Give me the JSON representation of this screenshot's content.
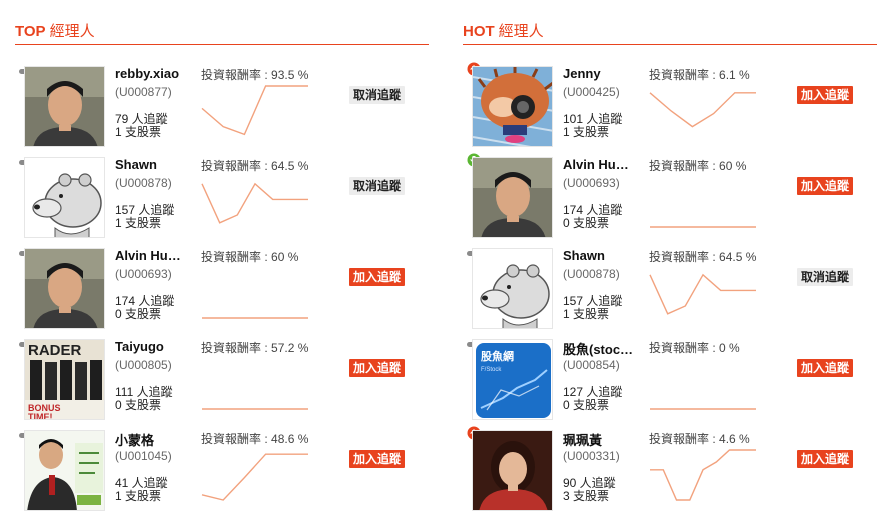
{
  "colors": {
    "accent": "#e8431e",
    "spark": "#f2a27e",
    "cancel_bg": "#ececec"
  },
  "return_label": "投資報酬率",
  "top": {
    "title_en": "TOP",
    "title_zh": "經理人",
    "rows": [
      {
        "name": "rebby.xiao",
        "id": "(U000877)",
        "rate": "93.5 %",
        "followers": "79 人追蹤",
        "stocks": "1 支股票",
        "badge": "dash",
        "avatar": "man-photo-icon",
        "button": "取消追蹤",
        "button_type": "cancel",
        "trend": [
          0.55,
          0.2,
          0.05,
          0.98,
          0.98,
          0.98
        ]
      },
      {
        "name": "Shawn",
        "id": "(U000878)",
        "rate": "64.5 %",
        "followers": "157 人追蹤",
        "stocks": "1 支股票",
        "badge": "dash",
        "avatar": "cartoon-bear-icon",
        "button": "取消追蹤",
        "button_type": "cancel",
        "trend": [
          0.85,
          0.1,
          0.25,
          0.85,
          0.55,
          0.55,
          0.55
        ]
      },
      {
        "name": "Alvin Hu…",
        "id": "(U000693)",
        "rate": "60 %",
        "followers": "174 人追蹤",
        "stocks": "0 支股票",
        "badge": "dash",
        "avatar": "man-photo-icon",
        "button": "加入追蹤",
        "button_type": "add",
        "trend": [
          0.02,
          0.02,
          0.02,
          0.02
        ]
      },
      {
        "name": "Taiyugo",
        "id": "(U000805)",
        "rate": "57.2 %",
        "followers": "111 人追蹤",
        "stocks": "0 支股票",
        "badge": "dash",
        "avatar": "magazine-cover-icon",
        "button": "加入追蹤",
        "button_type": "add",
        "trend": [
          0.02,
          0.02,
          0.02,
          0.02
        ]
      },
      {
        "name": "小蒙格",
        "id": "(U001045)",
        "rate": "48.6 %",
        "followers": "41 人追蹤",
        "stocks": "1 支股票",
        "badge": "dash",
        "avatar": "book-cover-icon",
        "button": "加入追蹤",
        "button_type": "add",
        "trend": [
          0.12,
          0.02,
          0.45,
          0.9,
          0.9,
          0.9
        ]
      }
    ]
  },
  "hot": {
    "title_en": "HOT",
    "title_zh": "經理人",
    "rows": [
      {
        "name": "Jenny",
        "id": "(U000425)",
        "rate": "6.1 %",
        "followers": "101 人追蹤",
        "stocks": "1 支股票",
        "badge": "up",
        "avatar": "cartoon-hedgehog-icon",
        "button": "加入追蹤",
        "button_type": "add",
        "trend": [
          0.85,
          0.5,
          0.2,
          0.45,
          0.85,
          0.85
        ]
      },
      {
        "name": "Alvin Hu…",
        "id": "(U000693)",
        "rate": "60 %",
        "followers": "174 人追蹤",
        "stocks": "0 支股票",
        "badge": "down",
        "avatar": "man-photo-icon",
        "button": "加入追蹤",
        "button_type": "add",
        "trend": [
          0.02,
          0.02,
          0.02,
          0.02
        ]
      },
      {
        "name": "Shawn",
        "id": "(U000878)",
        "rate": "64.5 %",
        "followers": "157 人追蹤",
        "stocks": "1 支股票",
        "badge": "dash",
        "avatar": "cartoon-bear-icon",
        "button": "取消追蹤",
        "button_type": "cancel",
        "trend": [
          0.85,
          0.1,
          0.25,
          0.85,
          0.55,
          0.55,
          0.55
        ]
      },
      {
        "name": "股魚(stoc…",
        "id": "(U000854)",
        "rate": "0 %",
        "followers": "127 人追蹤",
        "stocks": "0 支股票",
        "badge": "dash",
        "avatar": "stock-logo-icon",
        "button": "加入追蹤",
        "button_type": "add",
        "trend": [
          0.02,
          0.02,
          0.02,
          0.02
        ]
      },
      {
        "name": "珮珮黃",
        "id": "(U000331)",
        "rate": "4.6 %",
        "followers": "90 人追蹤",
        "stocks": "3 支股票",
        "badge": "up",
        "avatar": "woman-photo-icon",
        "button": "加入追蹤",
        "button_type": "add",
        "trend": [
          0.6,
          0.6,
          0.02,
          0.02,
          0.6,
          0.75,
          0.98,
          0.98,
          0.98
        ]
      }
    ]
  }
}
